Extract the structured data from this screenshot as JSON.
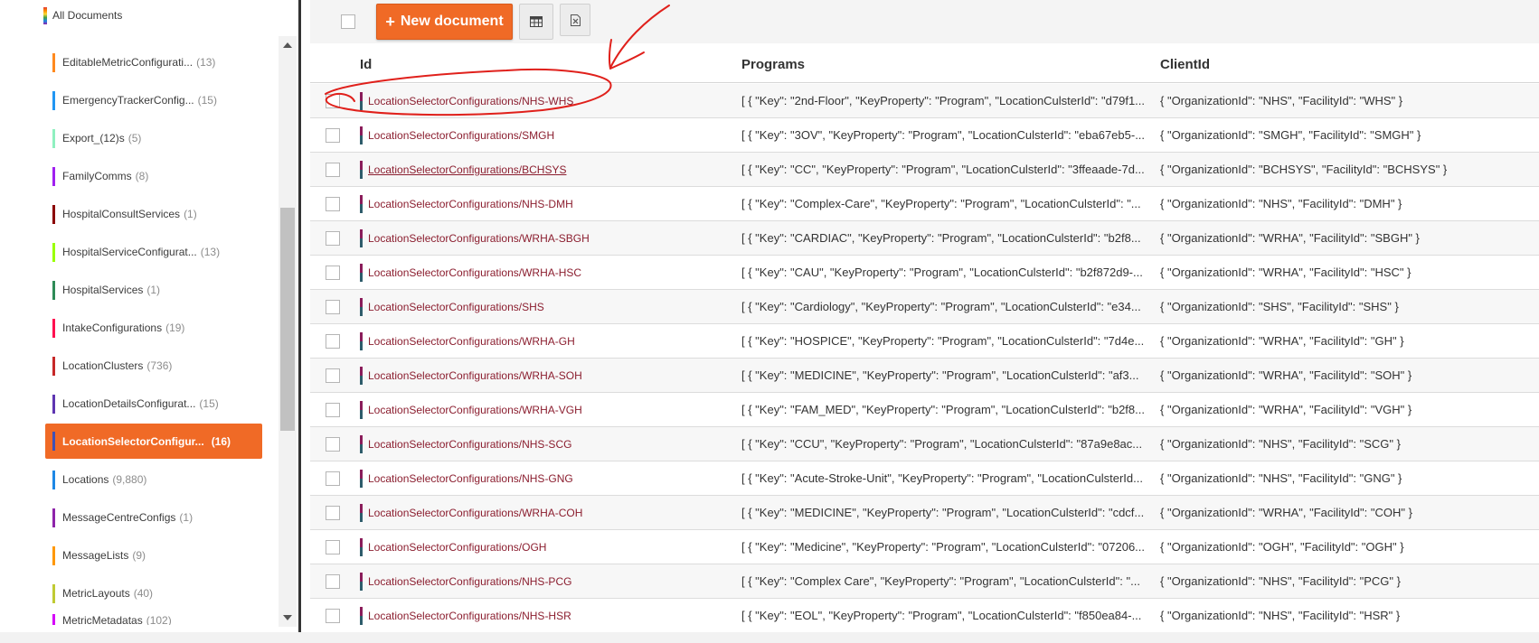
{
  "sidebar": {
    "all_documents": "All Documents",
    "items": [
      {
        "name": "EditableMetricConfigurati...",
        "count": "(13)",
        "color": "#ff8a1f",
        "active": false
      },
      {
        "name": "EmergencyTrackerConfig...",
        "count": "(15)",
        "color": "#2196f3",
        "active": false
      },
      {
        "name": "Export_(12)s",
        "count": "(5)",
        "color": "#8ff0c0",
        "active": false
      },
      {
        "name": "FamilyComms",
        "count": "(8)",
        "color": "#a020f0",
        "active": false
      },
      {
        "name": "HospitalConsultServices",
        "count": "(1)",
        "color": "#8b0000",
        "active": false
      },
      {
        "name": "HospitalServiceConfigurat...",
        "count": "(13)",
        "color": "#9aff00",
        "active": false
      },
      {
        "name": "HospitalServices",
        "count": "(1)",
        "color": "#2e8b57",
        "active": false
      },
      {
        "name": "IntakeConfigurations",
        "count": "(19)",
        "color": "#ff1050",
        "active": false
      },
      {
        "name": "LocationClusters",
        "count": "(736)",
        "color": "#c62828",
        "active": false
      },
      {
        "name": "LocationDetailsConfigurat...",
        "count": "(15)",
        "color": "#5e35b1",
        "active": false
      },
      {
        "name": "LocationSelectorConfigur...",
        "count": "(16)",
        "color": "#3f51b5",
        "active": true
      },
      {
        "name": "Locations",
        "count": "(9,880)",
        "color": "#1e88e5",
        "active": false
      },
      {
        "name": "MessageCentreConfigs",
        "count": "(1)",
        "color": "#8e24aa",
        "active": false
      },
      {
        "name": "MessageLists",
        "count": "(9)",
        "color": "#ff9800",
        "active": false
      },
      {
        "name": "MetricLayouts",
        "count": "(40)",
        "color": "#c0ca33",
        "active": false
      },
      {
        "name": "MetricMetadatas",
        "count": "(102)",
        "color": "#d500f9",
        "active": false
      }
    ]
  },
  "toolbar": {
    "new_document_label": "New document",
    "plus_glyph": "+",
    "grid_icon": "table-grid-icon",
    "excel_icon": "excel-export-icon"
  },
  "table": {
    "headers": {
      "id": "Id",
      "programs": "Programs",
      "client": "ClientId"
    },
    "rows": [
      {
        "id": "LocationSelectorConfigurations/NHS-WHS",
        "programs": "[ { \"Key\": \"2nd-Floor\", \"KeyProperty\": \"Program\", \"LocationCulsterId\": \"d79f1...",
        "client": "{ \"OrganizationId\": \"NHS\", \"FacilityId\": \"WHS\" }"
      },
      {
        "id": "LocationSelectorConfigurations/SMGH",
        "programs": "[ { \"Key\": \"3OV\", \"KeyProperty\": \"Program\", \"LocationCulsterId\": \"eba67eb5-...",
        "client": "{ \"OrganizationId\": \"SMGH\", \"FacilityId\": \"SMGH\" }"
      },
      {
        "id": "LocationSelectorConfigurations/BCHSYS",
        "programs": "[ { \"Key\": \"CC\", \"KeyProperty\": \"Program\", \"LocationCulsterId\": \"3ffeaade-7d...",
        "client": "{ \"OrganizationId\": \"BCHSYS\", \"FacilityId\": \"BCHSYS\" }"
      },
      {
        "id": "LocationSelectorConfigurations/NHS-DMH",
        "programs": "[ { \"Key\": \"Complex-Care\", \"KeyProperty\": \"Program\", \"LocationCulsterId\": \"...",
        "client": "{ \"OrganizationId\": \"NHS\", \"FacilityId\": \"DMH\" }"
      },
      {
        "id": "LocationSelectorConfigurations/WRHA-SBGH",
        "programs": "[ { \"Key\": \"CARDIAC\", \"KeyProperty\": \"Program\", \"LocationCulsterId\": \"b2f8...",
        "client": "{ \"OrganizationId\": \"WRHA\", \"FacilityId\": \"SBGH\" }"
      },
      {
        "id": "LocationSelectorConfigurations/WRHA-HSC",
        "programs": "[ { \"Key\": \"CAU\", \"KeyProperty\": \"Program\", \"LocationCulsterId\": \"b2f872d9-...",
        "client": "{ \"OrganizationId\": \"WRHA\", \"FacilityId\": \"HSC\" }"
      },
      {
        "id": "LocationSelectorConfigurations/SHS",
        "programs": "[ { \"Key\": \"Cardiology\", \"KeyProperty\": \"Program\", \"LocationCulsterId\": \"e34...",
        "client": "{ \"OrganizationId\": \"SHS\", \"FacilityId\": \"SHS\" }"
      },
      {
        "id": "LocationSelectorConfigurations/WRHA-GH",
        "programs": "[ { \"Key\": \"HOSPICE\", \"KeyProperty\": \"Program\", \"LocationCulsterId\": \"7d4e...",
        "client": "{ \"OrganizationId\": \"WRHA\", \"FacilityId\": \"GH\" }"
      },
      {
        "id": "LocationSelectorConfigurations/WRHA-SOH",
        "programs": "[ { \"Key\": \"MEDICINE\", \"KeyProperty\": \"Program\", \"LocationCulsterId\": \"af3...",
        "client": "{ \"OrganizationId\": \"WRHA\", \"FacilityId\": \"SOH\" }"
      },
      {
        "id": "LocationSelectorConfigurations/WRHA-VGH",
        "programs": "[ { \"Key\": \"FAM_MED\", \"KeyProperty\": \"Program\", \"LocationCulsterId\": \"b2f8...",
        "client": "{ \"OrganizationId\": \"WRHA\", \"FacilityId\": \"VGH\" }"
      },
      {
        "id": "LocationSelectorConfigurations/NHS-SCG",
        "programs": "[ { \"Key\": \"CCU\", \"KeyProperty\": \"Program\", \"LocationCulsterId\": \"87a9e8ac...",
        "client": "{ \"OrganizationId\": \"NHS\", \"FacilityId\": \"SCG\" }"
      },
      {
        "id": "LocationSelectorConfigurations/NHS-GNG",
        "programs": "[ { \"Key\": \"Acute-Stroke-Unit\", \"KeyProperty\": \"Program\", \"LocationCulsterId...",
        "client": "{ \"OrganizationId\": \"NHS\", \"FacilityId\": \"GNG\" }"
      },
      {
        "id": "LocationSelectorConfigurations/WRHA-COH",
        "programs": "[ { \"Key\": \"MEDICINE\", \"KeyProperty\": \"Program\", \"LocationCulsterId\": \"cdcf...",
        "client": "{ \"OrganizationId\": \"WRHA\", \"FacilityId\": \"COH\" }"
      },
      {
        "id": "LocationSelectorConfigurations/OGH",
        "programs": "[ { \"Key\": \"Medicine\", \"KeyProperty\": \"Program\", \"LocationCulsterId\": \"07206...",
        "client": "{ \"OrganizationId\": \"OGH\", \"FacilityId\": \"OGH\" }"
      },
      {
        "id": "LocationSelectorConfigurations/NHS-PCG",
        "programs": "[ { \"Key\": \"Complex Care\", \"KeyProperty\": \"Program\", \"LocationCulsterId\": \"...",
        "client": "{ \"OrganizationId\": \"NHS\", \"FacilityId\": \"PCG\" }"
      },
      {
        "id": "LocationSelectorConfigurations/NHS-HSR",
        "programs": "[ { \"Key\": \"EOL\", \"KeyProperty\": \"Program\", \"LocationCulsterId\": \"f850ea84-...",
        "client": "{ \"OrganizationId\": \"NHS\", \"FacilityId\": \"HSR\" }"
      }
    ]
  },
  "colors": {
    "accent": "#f06a26",
    "link": "#8b1e2f",
    "annotation": "#e0201b"
  }
}
